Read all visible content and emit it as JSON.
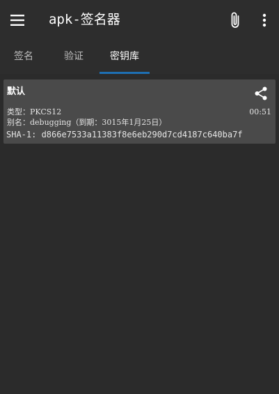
{
  "toolbar": {
    "title": "apk-签名器",
    "menu_icon": "hamburger-menu-icon",
    "attach_icon": "paperclip-icon",
    "more_icon": "more-vertical-icon"
  },
  "tabs": [
    {
      "label": "签名",
      "active": false
    },
    {
      "label": "验证",
      "active": false
    },
    {
      "label": "密钥库",
      "active": true
    }
  ],
  "keystore_card": {
    "name": "默认",
    "share_icon": "share-icon",
    "type_line": "类型：PKCS12",
    "alias_line": "别名：debugging（到期：3015年1月25日）",
    "time": "00:51",
    "sha1": "SHA-1: d866e7533a11383f8e6eb290d7cd4187c640ba7f"
  },
  "colors": {
    "background": "#2b2b2b",
    "toolbar": "#2d2d2d",
    "card": "#4a4a4a",
    "accent": "#1e6fb3",
    "text": "#ffffff"
  }
}
